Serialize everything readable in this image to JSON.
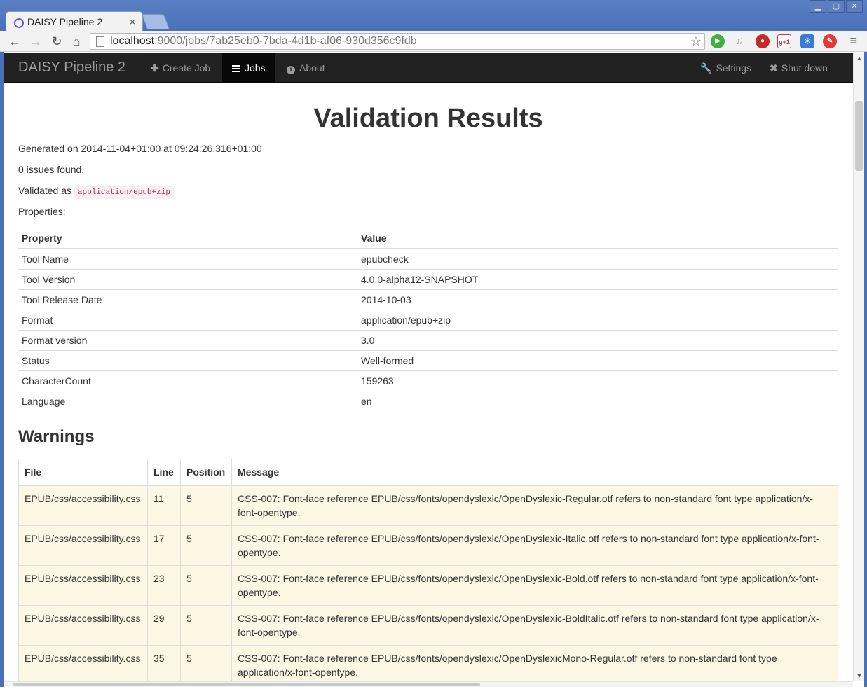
{
  "browser": {
    "tab_title": "DAISY Pipeline 2",
    "tab_close": "×",
    "url_host": "localhost",
    "url_rest": ":9000/jobs/7ab25eb0-7bda-4d1b-af06-930d356c9fdb",
    "extensions": [
      "play-icon",
      "bell-icon",
      "stop-icon",
      "gplus-icon",
      "app-icon",
      "badge-icon"
    ],
    "gplus_label": "g+1"
  },
  "navbar": {
    "brand": "DAISY Pipeline 2",
    "items": [
      {
        "label": "Create Job",
        "icon": "plus-icon"
      },
      {
        "label": "Jobs",
        "icon": "list-icon",
        "active": true
      },
      {
        "label": "About",
        "icon": "info-icon"
      }
    ],
    "right_items": [
      {
        "label": "Settings",
        "icon": "wrench-icon"
      },
      {
        "label": "Shut down",
        "icon": "close-icon"
      }
    ]
  },
  "main": {
    "title": "Validation Results",
    "generated": "Generated on 2014-11-04+01:00 at 09:24:26.316+01:00",
    "issues": "0 issues found.",
    "validated_as_label": "Validated as",
    "validated_as_value": "application/epub+zip",
    "properties_label": "Properties:",
    "properties_table": {
      "headers": [
        "Property",
        "Value"
      ],
      "rows": [
        [
          "Tool Name",
          "epubcheck"
        ],
        [
          "Tool Version",
          "4.0.0-alpha12-SNAPSHOT"
        ],
        [
          "Tool Release Date",
          "2014-10-03"
        ],
        [
          "Format",
          "application/epub+zip"
        ],
        [
          "Format version",
          "3.0"
        ],
        [
          "Status",
          "Well-formed"
        ],
        [
          "CharacterCount",
          "159263"
        ],
        [
          "Language",
          "en"
        ]
      ]
    },
    "warnings_heading": "Warnings",
    "warnings_table": {
      "headers": [
        "File",
        "Line",
        "Position",
        "Message"
      ],
      "rows": [
        [
          "EPUB/css/accessibility.css",
          "11",
          "5",
          "CSS-007: Font-face reference EPUB/css/fonts/opendyslexic/OpenDyslexic-Regular.otf refers to non-standard font type application/x-font-opentype."
        ],
        [
          "EPUB/css/accessibility.css",
          "17",
          "5",
          "CSS-007: Font-face reference EPUB/css/fonts/opendyslexic/OpenDyslexic-Italic.otf refers to non-standard font type application/x-font-opentype."
        ],
        [
          "EPUB/css/accessibility.css",
          "23",
          "5",
          "CSS-007: Font-face reference EPUB/css/fonts/opendyslexic/OpenDyslexic-Bold.otf refers to non-standard font type application/x-font-opentype."
        ],
        [
          "EPUB/css/accessibility.css",
          "29",
          "5",
          "CSS-007: Font-face reference EPUB/css/fonts/opendyslexic/OpenDyslexic-BoldItalic.otf refers to non-standard font type application/x-font-opentype."
        ],
        [
          "EPUB/css/accessibility.css",
          "35",
          "5",
          "CSS-007: Font-face reference EPUB/css/fonts/opendyslexic/OpenDyslexicMono-Regular.otf refers to non-standard font type application/x-font-opentype."
        ]
      ]
    }
  },
  "colors": {
    "navbar_bg": "#222222",
    "warning_row_bg": "#fcf8e3",
    "code_text": "#c7254e"
  }
}
